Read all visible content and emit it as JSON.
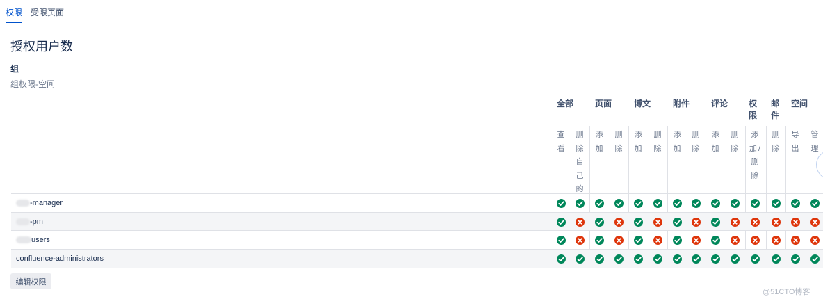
{
  "tabs": [
    {
      "label": "权限",
      "active": true
    },
    {
      "label": "受限页面",
      "active": false
    }
  ],
  "title": "授权用户数",
  "section": {
    "title": "组",
    "subtitle": "组权限-空间"
  },
  "column_groups": [
    {
      "label": "全部"
    },
    {
      "label": "页面"
    },
    {
      "label": "博文"
    },
    {
      "label": "附件"
    },
    {
      "label": "评论"
    },
    {
      "label": "权\n限"
    },
    {
      "label": "邮\n件"
    },
    {
      "label": "空间"
    }
  ],
  "columns": [
    {
      "label": "查\n看"
    },
    {
      "label": "删\n除\n自\n己\n的"
    },
    {
      "label": "添\n加"
    },
    {
      "label": "删\n除"
    },
    {
      "label": "添\n加"
    },
    {
      "label": "删\n除"
    },
    {
      "label": "添\n加"
    },
    {
      "label": "删\n除"
    },
    {
      "label": "添\n加"
    },
    {
      "label": "删\n除"
    },
    {
      "label": "添\n加/\n删\n除"
    },
    {
      "label": "删\n除"
    },
    {
      "label": "导\n出"
    },
    {
      "label": "管\n理"
    }
  ],
  "rows": [
    {
      "prefix_hidden": true,
      "name": "-manager",
      "perms": [
        true,
        true,
        true,
        true,
        true,
        true,
        true,
        true,
        true,
        true,
        true,
        true,
        true,
        true
      ]
    },
    {
      "prefix_hidden": true,
      "name": "-pm",
      "perms": [
        true,
        false,
        true,
        false,
        true,
        false,
        true,
        false,
        true,
        false,
        false,
        false,
        false,
        false
      ]
    },
    {
      "prefix_hidden": true,
      "name": "users",
      "perms": [
        true,
        false,
        true,
        false,
        true,
        false,
        true,
        false,
        true,
        false,
        false,
        false,
        false,
        false
      ]
    },
    {
      "prefix_hidden": false,
      "name": "confluence-administrators",
      "perms": [
        true,
        true,
        true,
        true,
        true,
        true,
        true,
        true,
        true,
        true,
        true,
        true,
        true,
        true
      ]
    }
  ],
  "edit_button": "编辑权限",
  "watermark": "@51CTO博客",
  "colors": {
    "granted": "#00875a",
    "denied": "#de350b",
    "accent": "#0052cc"
  },
  "icons": {
    "granted": "check-circle-icon",
    "denied": "cross-circle-icon"
  }
}
